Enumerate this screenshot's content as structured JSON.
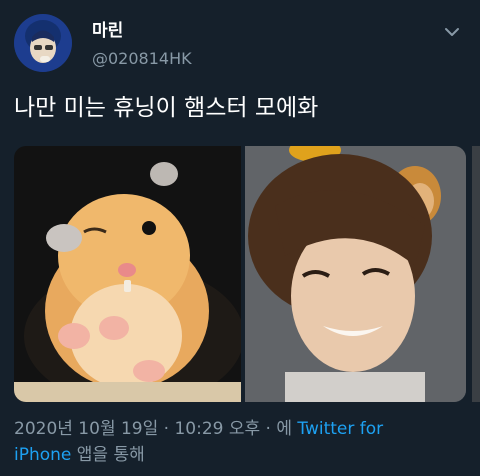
{
  "author": {
    "display_name": "마린",
    "handle": "@020814HK"
  },
  "tweet": {
    "text": "나만 미는 휴닝이 햄스터 모에화"
  },
  "meta": {
    "date": "2020년 10월 19일 · 10:29 오후 · 에",
    "source_line1": "Twitter for",
    "source_line2": "iPhone",
    "suffix": " 앱을 통해"
  },
  "colors": {
    "background": "#15202b",
    "link": "#1da1f2",
    "secondary_text": "#8899a6"
  },
  "icons": {
    "chevron": "chevron-down-icon"
  }
}
